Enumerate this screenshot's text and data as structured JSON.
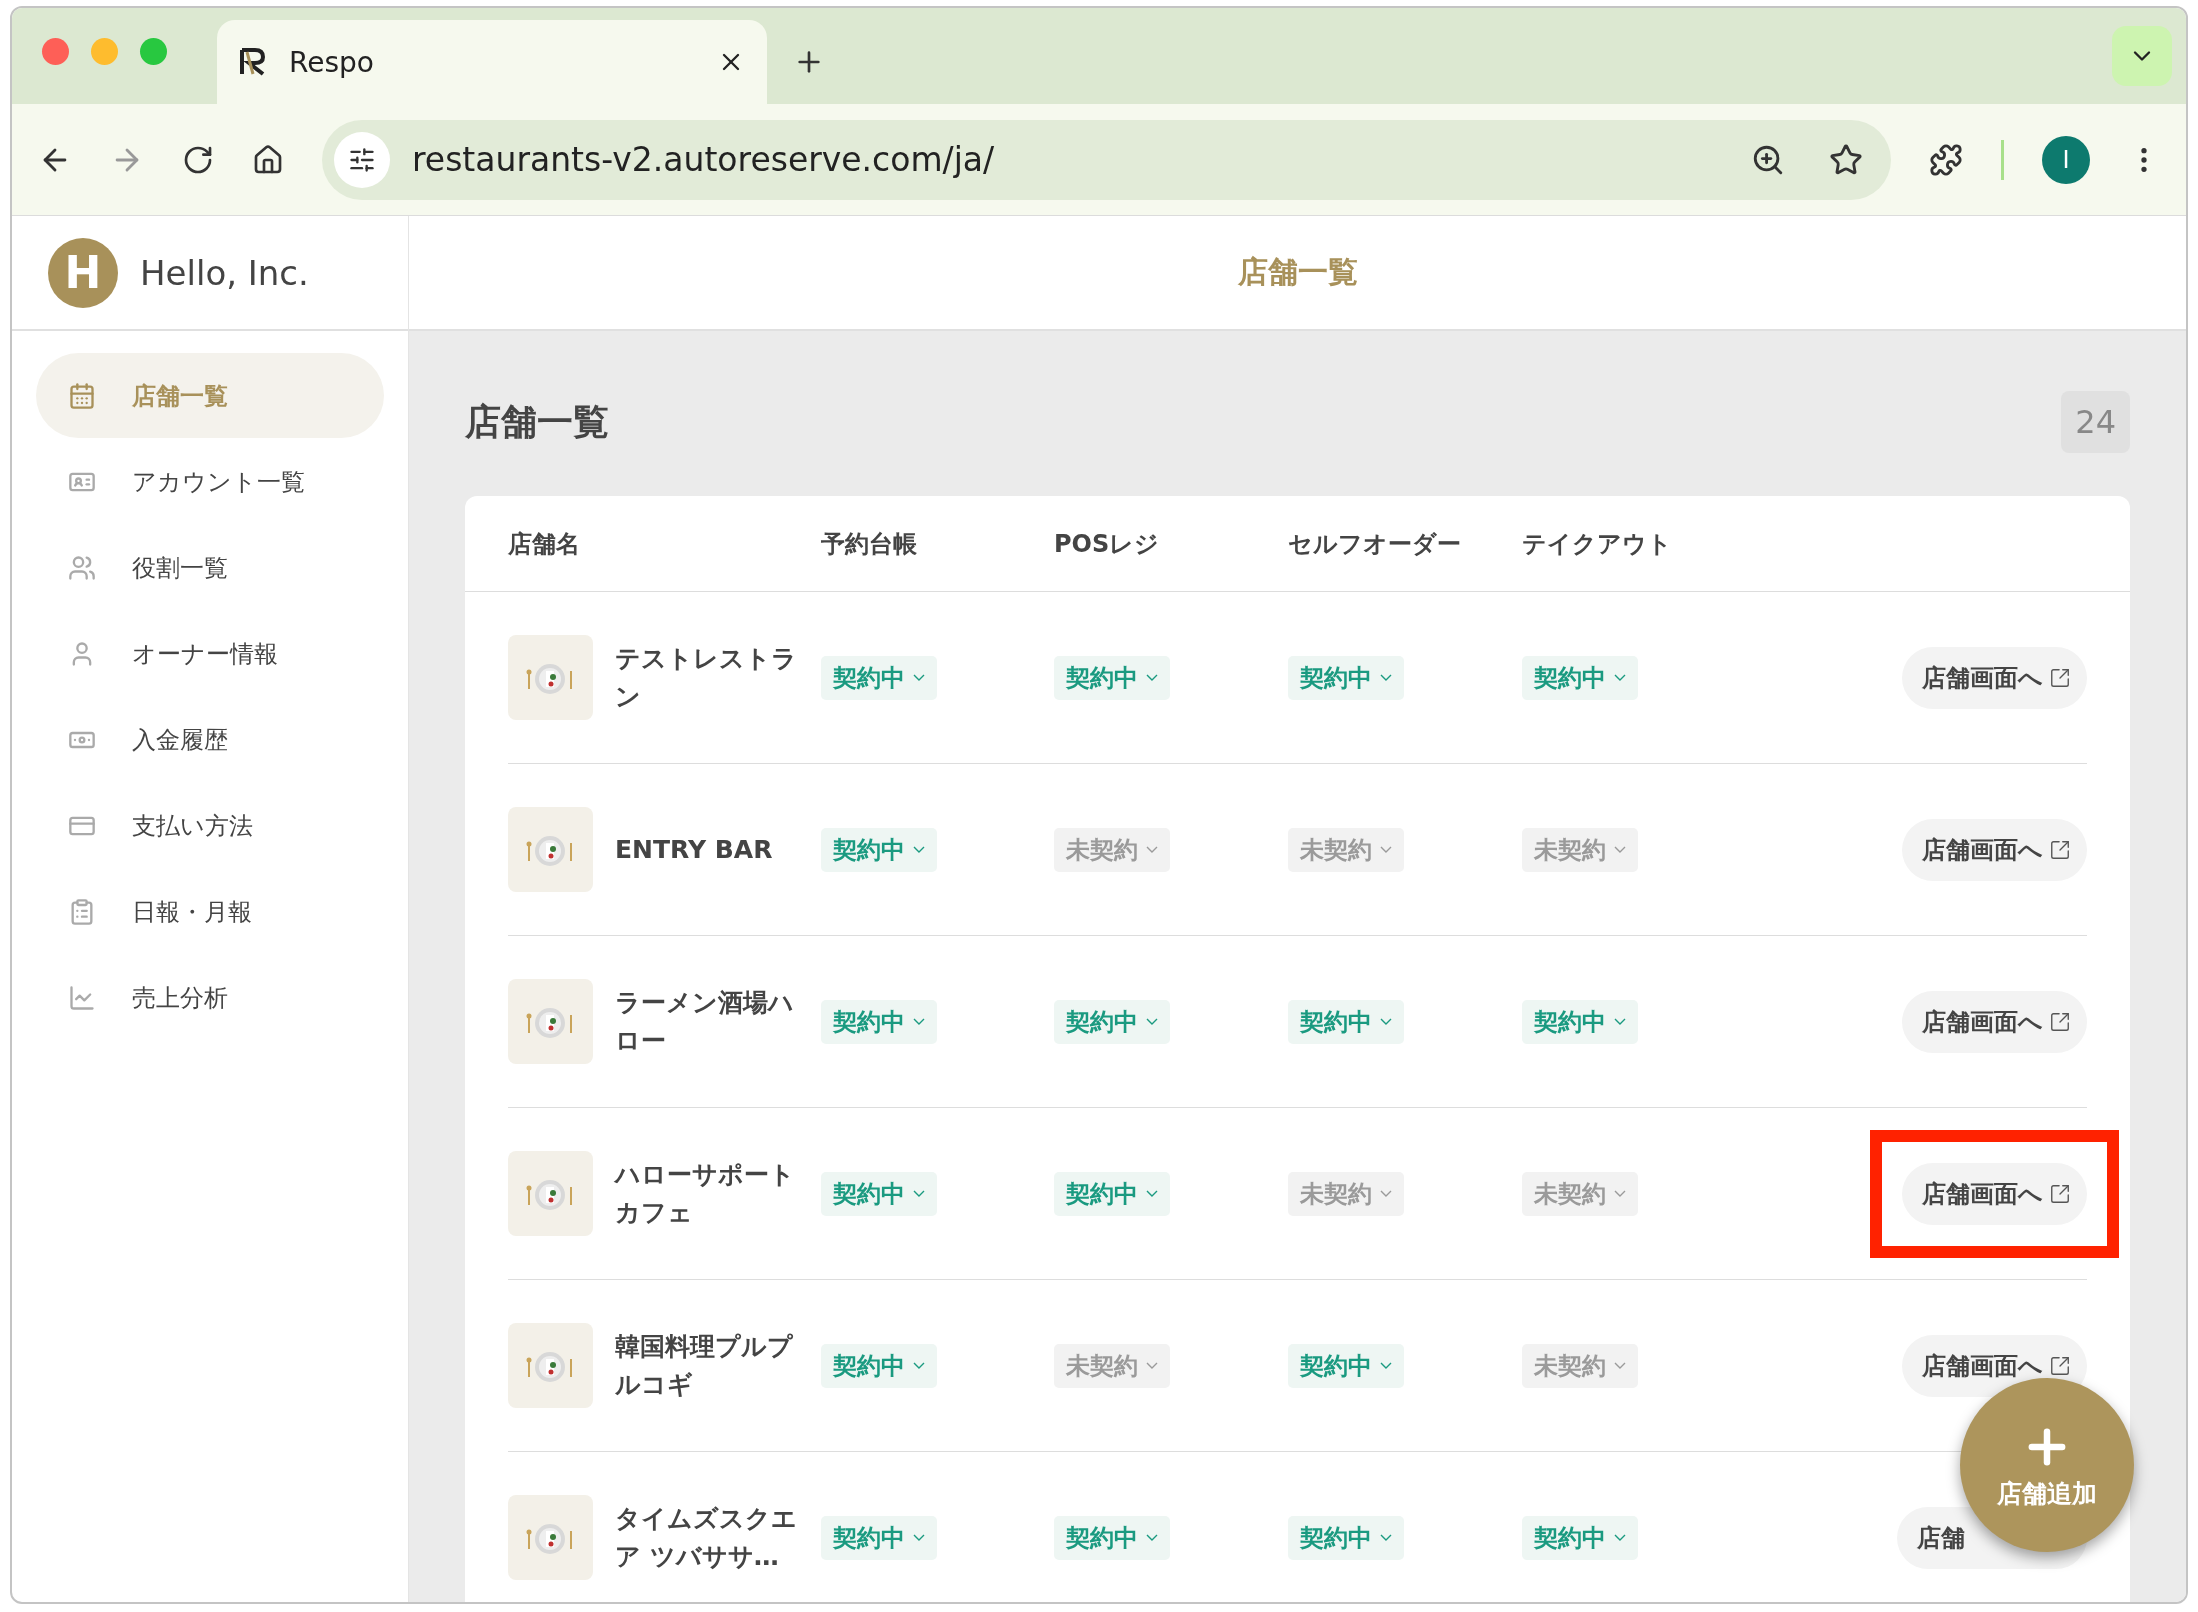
{
  "browser": {
    "tab_title": "Respo",
    "url": "restaurants-v2.autoreserve.com/ja/",
    "profile_initial": "I"
  },
  "sidebar": {
    "logo_letter": "H",
    "company": "Hello, Inc.",
    "items": [
      {
        "label": "店舗一覧",
        "selected": true
      },
      {
        "label": "アカウント一覧",
        "selected": false
      },
      {
        "label": "役割一覧",
        "selected": false
      },
      {
        "label": "オーナー情報",
        "selected": false
      },
      {
        "label": "入金履歴",
        "selected": false
      },
      {
        "label": "支払い方法",
        "selected": false
      },
      {
        "label": "日報・月報",
        "selected": false
      },
      {
        "label": "売上分析",
        "selected": false
      }
    ]
  },
  "header_title": "店舗一覧",
  "page": {
    "title": "店舗一覧",
    "count": "24"
  },
  "table": {
    "columns": [
      "店舗名",
      "予約台帳",
      "POSレジ",
      "セルフオーダー",
      "テイクアウト"
    ],
    "rows": [
      {
        "name": "テストレストラン",
        "statuses": [
          {
            "label": "契約中",
            "active": true
          },
          {
            "label": "契約中",
            "active": true
          },
          {
            "label": "契約中",
            "active": true
          },
          {
            "label": "契約中",
            "active": true
          }
        ],
        "link": "店舗画面へ",
        "highlighted": false
      },
      {
        "name": "ENTRY BAR",
        "statuses": [
          {
            "label": "契約中",
            "active": true
          },
          {
            "label": "未契約",
            "active": false
          },
          {
            "label": "未契約",
            "active": false
          },
          {
            "label": "未契約",
            "active": false
          }
        ],
        "link": "店舗画面へ",
        "highlighted": false
      },
      {
        "name": "ラーメン酒場ハロー",
        "statuses": [
          {
            "label": "契約中",
            "active": true
          },
          {
            "label": "契約中",
            "active": true
          },
          {
            "label": "契約中",
            "active": true
          },
          {
            "label": "契約中",
            "active": true
          }
        ],
        "link": "店舗画面へ",
        "highlighted": false
      },
      {
        "name": "ハローサポートカフェ",
        "statuses": [
          {
            "label": "契約中",
            "active": true
          },
          {
            "label": "契約中",
            "active": true
          },
          {
            "label": "未契約",
            "active": false
          },
          {
            "label": "未契約",
            "active": false
          }
        ],
        "link": "店舗画面へ",
        "highlighted": true
      },
      {
        "name": "韓国料理プルプルコギ",
        "statuses": [
          {
            "label": "契約中",
            "active": true
          },
          {
            "label": "未契約",
            "active": false
          },
          {
            "label": "契約中",
            "active": true
          },
          {
            "label": "未契約",
            "active": false
          }
        ],
        "link": "店舗画面へ",
        "highlighted": false
      },
      {
        "name": "タイムズスクエア ツバササ…",
        "statuses": [
          {
            "label": "契約中",
            "active": true
          },
          {
            "label": "契約中",
            "active": true
          },
          {
            "label": "契約中",
            "active": true
          },
          {
            "label": "契約中",
            "active": true
          }
        ],
        "link": "店舗",
        "link_icon": false,
        "highlighted": false
      }
    ]
  },
  "fab": {
    "label": "店舗追加"
  }
}
